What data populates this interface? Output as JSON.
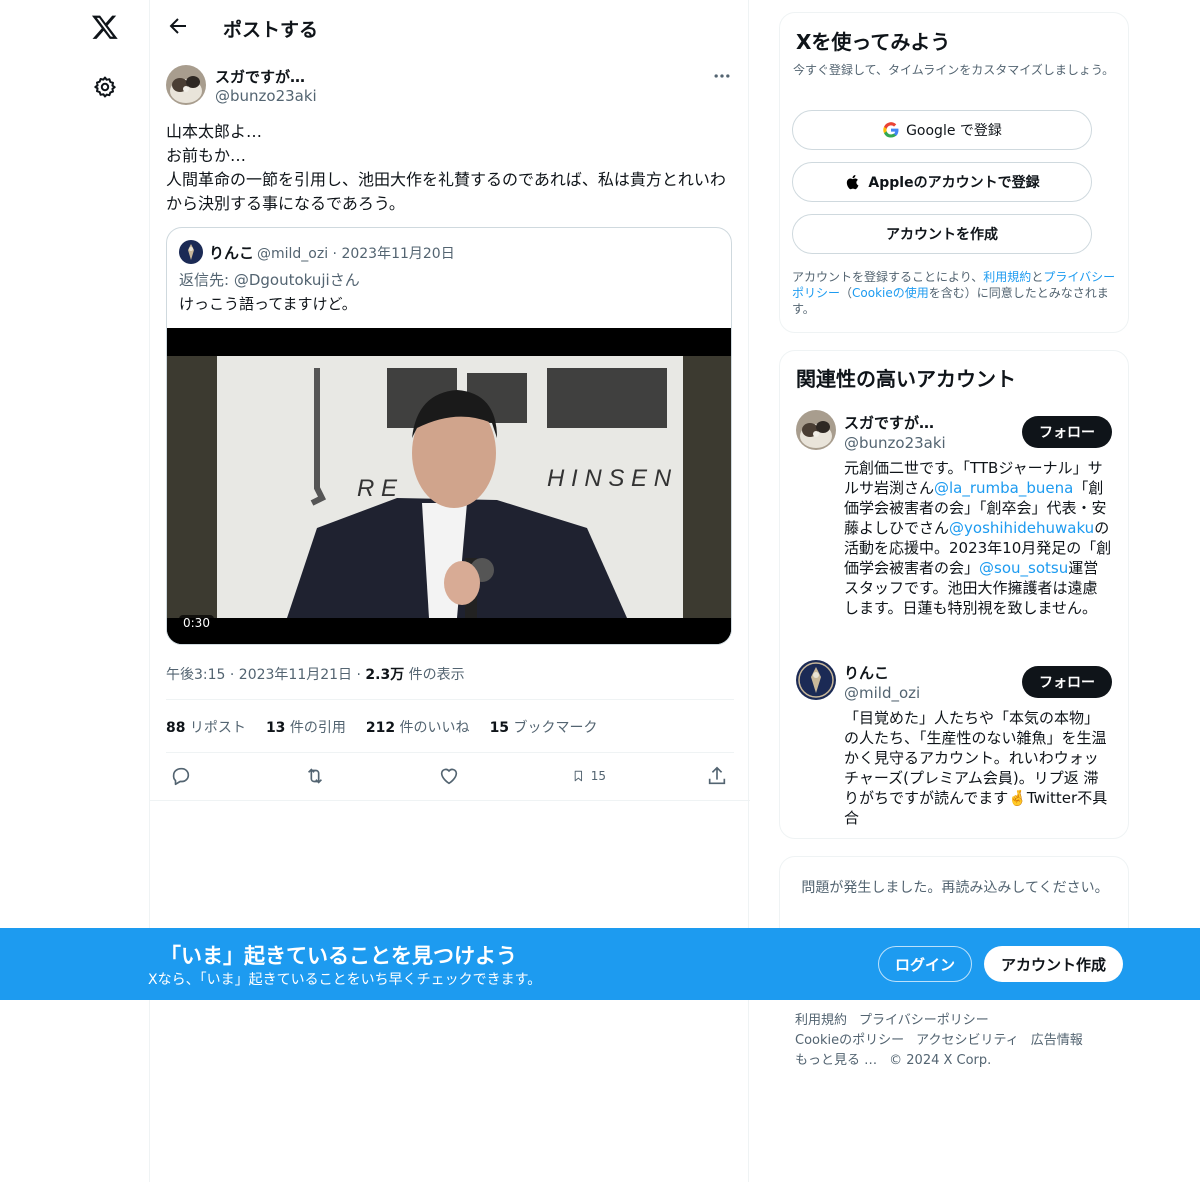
{
  "nav": {
    "logo": "x-logo-icon",
    "settings": "gear-icon"
  },
  "header": {
    "title": "ポストする"
  },
  "tweet": {
    "author_name": "スガですが…",
    "author_handle": "@bunzo23aki",
    "text": "山本太郎よ…\nお前もか…\n人間革命の一節を引用し、池田大作を礼賛するのであれば、私は貴方とれいわから決別する事になるであろう。",
    "quote": {
      "name": "りんこ",
      "handle_date": "@mild_ozi · 2023年11月20日",
      "reply_prefix": "返信先: ",
      "reply_to": "@Dgoutokujiさん",
      "text": "けっこう語ってますけど。",
      "video_duration": "0:30"
    },
    "time": "午後3:15 · 2023年11月21日 · ",
    "views_count": "2.3万",
    "views_label": " 件の表示",
    "stats": [
      {
        "count": "88",
        "label": " リポスト"
      },
      {
        "count": "13",
        "label": " 件の引用"
      },
      {
        "count": "212",
        "label": " 件のいいね"
      },
      {
        "count": "15",
        "label": " ブックマーク"
      }
    ],
    "bookmark_count": "15"
  },
  "signup": {
    "title": "Xを使ってみよう",
    "desc": "今すぐ登録して、タイムラインをカスタマイズしましょう。",
    "google": "Google で登録",
    "apple": "Appleのアカウントで登録",
    "create": "アカウントを作成",
    "legal_1": "アカウントを登録することにより、",
    "legal_terms": "利用規約",
    "legal_2": "と",
    "legal_privacy": "プライバシーポリシー",
    "legal_3": "（",
    "legal_cookie": "Cookieの使用",
    "legal_4": "を含む）に同意したとみなされます。"
  },
  "related": {
    "title": "関連性の高いアカウント",
    "follow_label": "フォロー",
    "accounts": [
      {
        "name": "スガですが…",
        "handle": "@bunzo23aki",
        "bio_1": "元創価二世です。「TTBジャーナル」サルサ岩渕さん",
        "bio_link_1": "@la_rumba_buena",
        "bio_2": "「創価学会被害者の会」「創卒会」代表・安藤よしひでさん",
        "bio_link_2": "@yoshihidehuwaku",
        "bio_3": "の活動を応援中。2023年10月発足の「創価学会被害者の会」",
        "bio_link_3": "@sou_sotsu",
        "bio_4": "運営スタッフです。池田大作擁護者は遠慮します。日蓮も特別視を致しません。"
      },
      {
        "name": "りんこ",
        "handle": "@mild_ozi",
        "bio_1": "「目覚めた」人たちや「本気の本物」の人たち、「生産性のない雑魚」を生温かく見守るアカウント。れいわウォッチャーズ(プレミアム会員)。リプ返 滞りがちですが読んでます🤞Twitter不具合"
      }
    ]
  },
  "error": {
    "text": "問題が発生しました。再読み込みしてください。"
  },
  "footer": {
    "links": [
      "利用規約",
      "プライバシーポリシー",
      "Cookieのポリシー",
      "アクセシビリティ",
      "広告情報",
      "もっと見る …",
      "© 2024 X Corp."
    ]
  },
  "banner": {
    "title": "「いま」起きていることを見つけよう",
    "subtitle": "Xなら、「いま」起きていることをいち早くチェックできます。",
    "login": "ログイン",
    "create": "アカウント作成"
  },
  "colors": {
    "accent": "#1d9bf0",
    "text": "#0f1419",
    "muted": "#536471"
  }
}
